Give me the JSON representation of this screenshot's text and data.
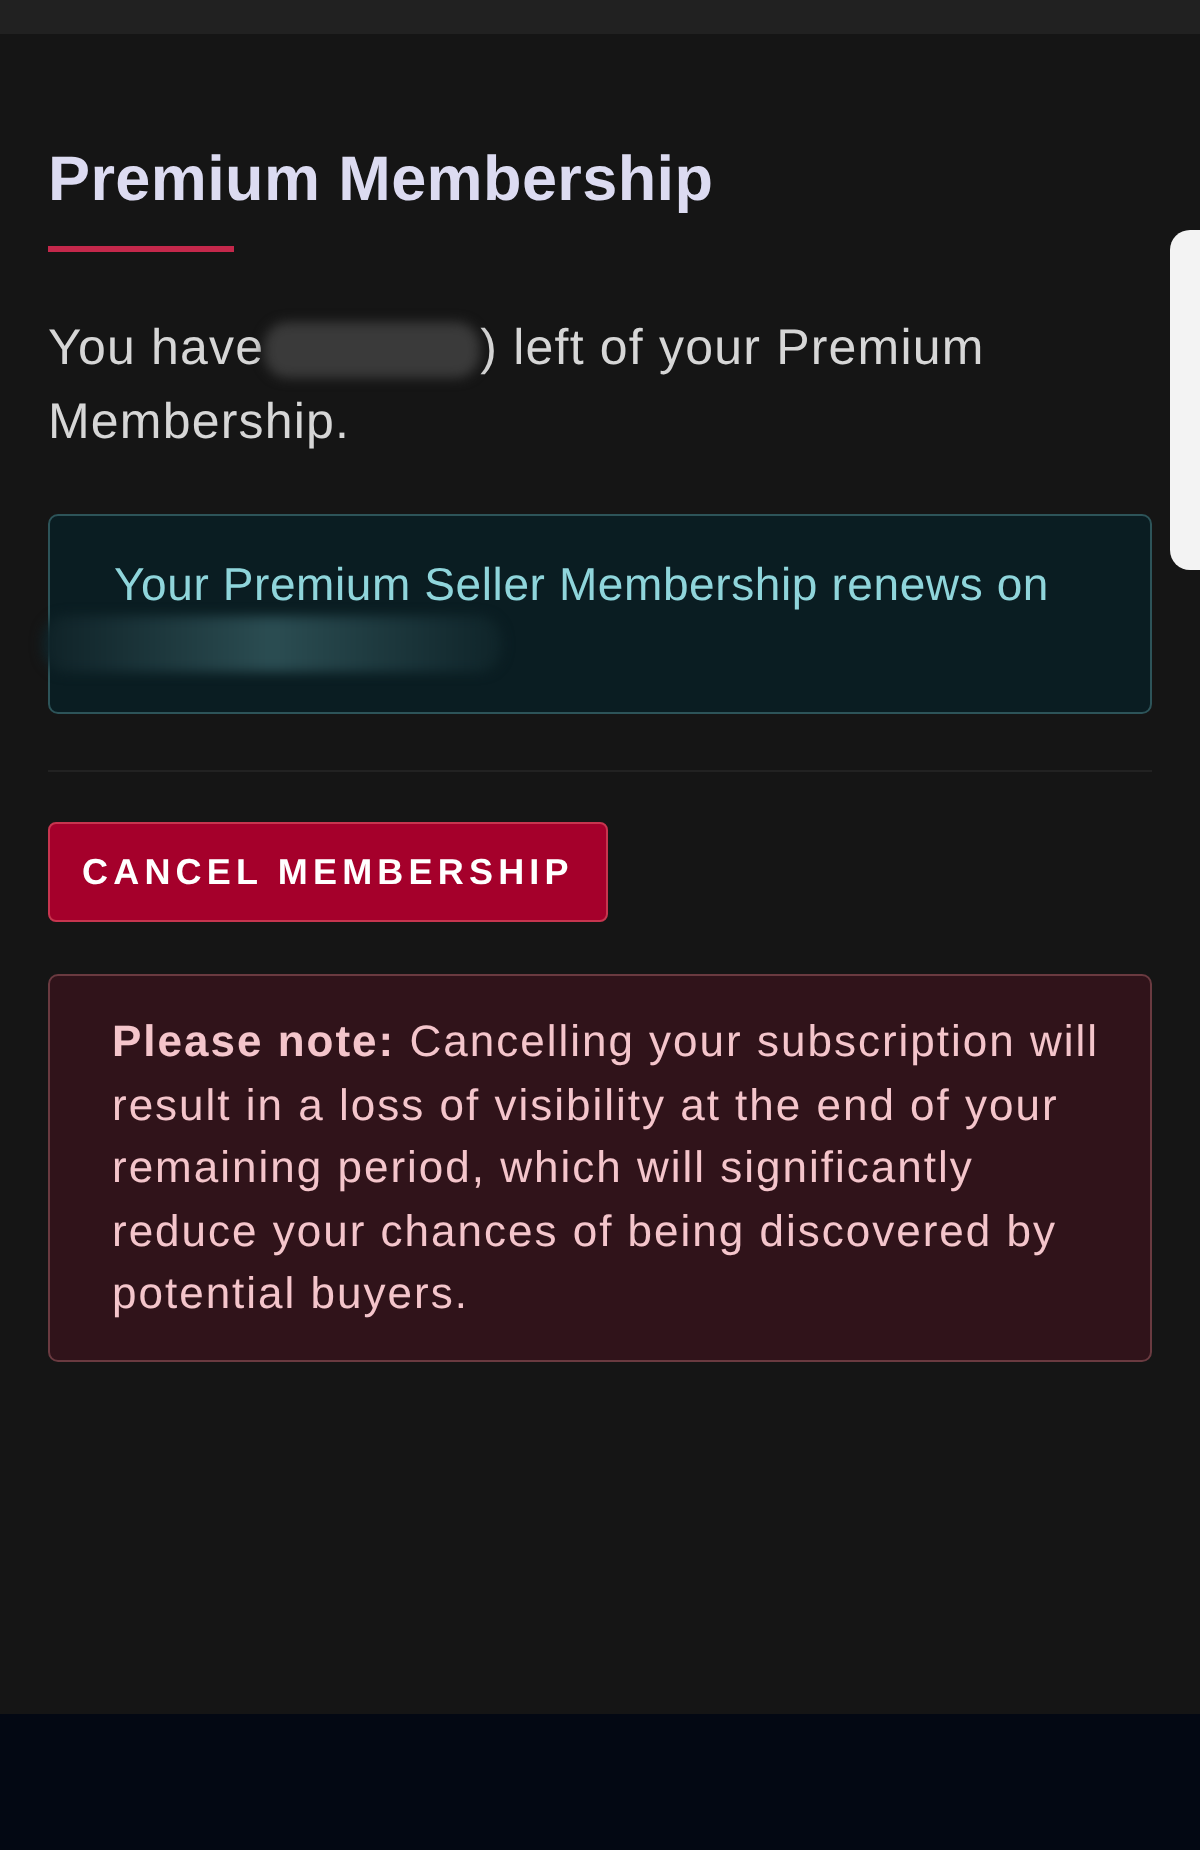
{
  "page": {
    "title": "Premium Membership"
  },
  "remaining": {
    "before": "You have",
    "redacted": true,
    "after_lines": [
      ") left of your Premium",
      "Membership."
    ]
  },
  "renewal_notice": {
    "text": "Your Premium Seller Membership renews on",
    "date_redacted": true
  },
  "cancel_button": {
    "label": "CANCEL MEMBERSHIP"
  },
  "warning": {
    "text": "**Please note:** Cancelling your subscription will result in a loss of visibility at the end of your remaining period, which will significantly reduce your chances of being discovered by potential buyers."
  }
}
